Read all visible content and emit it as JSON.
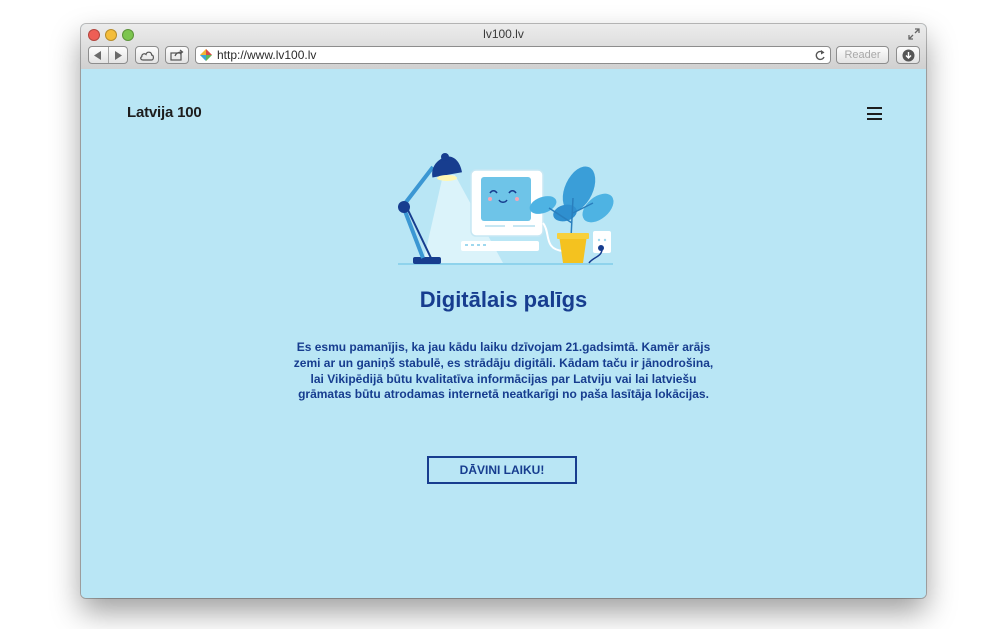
{
  "window": {
    "title": "lv100.lv"
  },
  "toolbar": {
    "url": "http://www.lv100.lv",
    "reader_label": "Reader"
  },
  "page": {
    "logo": "Latvija 100",
    "heading": "Digitālais palīgs",
    "paragraph": "Es esmu pamanījis, ka jau kādu laiku dzīvojam 21.gadsimtā. Kamēr arājs zemi ar un ganiņš stabulē, es strādāju digitāli. Kādam taču ir jānodrošina, lai Vikipēdijā būtu kvalitatīva informācijas par Latviju vai lai latviešu grāmatas būtu atrodamas internetā neatkarīgi no paša lasītāja lokācijas.",
    "cta_label": "DĀVINI LAIKU!",
    "icons": {
      "menu": "hamburger-menu-icon",
      "illustration": "desk-lamp-computer-plant-illustration"
    }
  },
  "colors": {
    "background": "#b9e6f5",
    "primary_text": "#173d8f",
    "logo_text": "#1d1d1d"
  }
}
